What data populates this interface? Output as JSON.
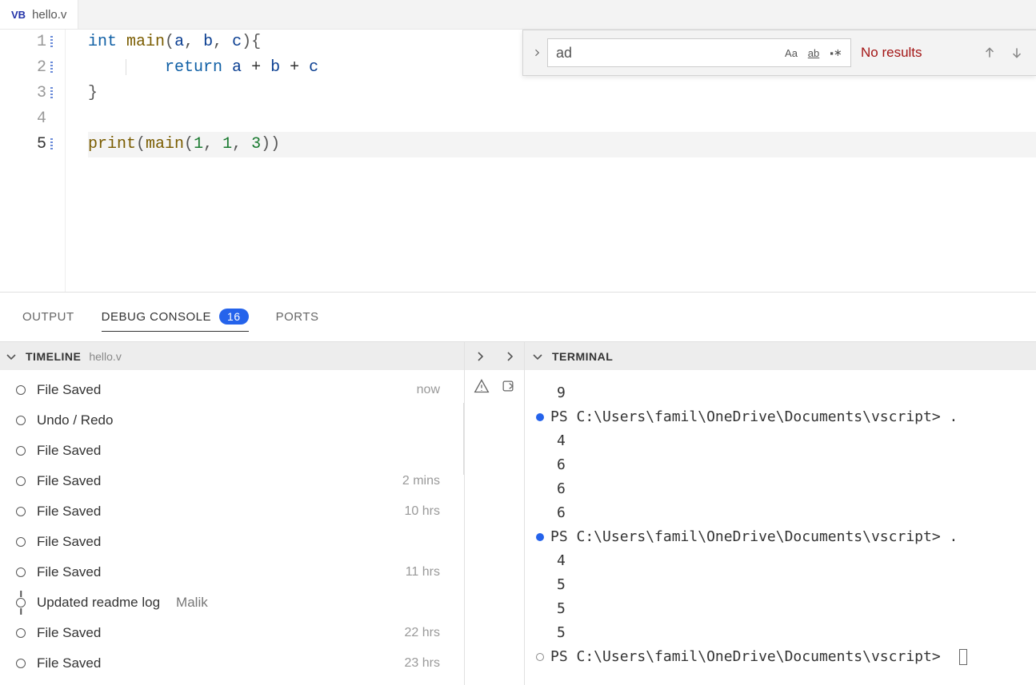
{
  "tab": {
    "langBadge": "VB",
    "filename": "hello.v"
  },
  "editor": {
    "lines": [
      {
        "n": "1"
      },
      {
        "n": "2"
      },
      {
        "n": "3"
      },
      {
        "n": "4"
      },
      {
        "n": "5",
        "active": true
      }
    ],
    "code": {
      "l1": {
        "kw": "int",
        "fn": "main",
        "p1": "(",
        "v1": "a",
        "c1": ", ",
        "v2": "b",
        "c2": ", ",
        "v3": "c",
        "p2": ")",
        "brace": "{"
      },
      "l2": {
        "kw": "return",
        "v1": "a",
        "op1": " + ",
        "v2": "b",
        "op2": " + ",
        "v3": "c"
      },
      "l3": {
        "brace": "}"
      },
      "l5": {
        "fn1": "print",
        "p1": "(",
        "fn2": "main",
        "p2": "(",
        "n1": "1",
        "c1": ", ",
        "n2": "1",
        "c2": ", ",
        "n3": "3",
        "p3": ")",
        "p4": ")"
      }
    }
  },
  "find": {
    "value": "ad",
    "opts": {
      "case": "Aa",
      "word": "ab",
      "regex": "∗"
    },
    "result": "No results"
  },
  "panelTabs": {
    "output": "OUTPUT",
    "debug": "DEBUG CONSOLE",
    "debugBadge": "16",
    "ports": "PORTS"
  },
  "timeline": {
    "title": "TIMELINE",
    "sub": "hello.v",
    "items": [
      {
        "label": "File Saved",
        "time": "now"
      },
      {
        "label": "Undo / Redo",
        "time": ""
      },
      {
        "label": "File Saved",
        "time": ""
      },
      {
        "label": "File Saved",
        "time": "2 mins"
      },
      {
        "label": "File Saved",
        "time": "10 hrs"
      },
      {
        "label": "File Saved",
        "time": ""
      },
      {
        "label": "File Saved",
        "time": "11 hrs"
      },
      {
        "label": "Updated readme log",
        "time": "",
        "author": "Malik",
        "commit": true
      },
      {
        "label": "File Saved",
        "time": "22 hrs"
      },
      {
        "label": "File Saved",
        "time": "23 hrs"
      }
    ]
  },
  "terminal": {
    "title": "TERMINAL",
    "lines": [
      {
        "text": "9",
        "indent": true
      },
      {
        "dot": "blue",
        "text": "PS C:\\Users\\famil\\OneDrive\\Documents\\vscript> ."
      },
      {
        "text": "4",
        "indent": true
      },
      {
        "text": "6",
        "indent": true
      },
      {
        "text": "6",
        "indent": true
      },
      {
        "text": "6",
        "indent": true
      },
      {
        "dot": "blue",
        "text": "PS C:\\Users\\famil\\OneDrive\\Documents\\vscript> ."
      },
      {
        "text": "4",
        "indent": true
      },
      {
        "text": "5",
        "indent": true
      },
      {
        "text": "5",
        "indent": true
      },
      {
        "text": "5",
        "indent": true
      },
      {
        "dot": "hollow",
        "text": "PS C:\\Users\\famil\\OneDrive\\Documents\\vscript> ",
        "cursor": true
      }
    ]
  }
}
